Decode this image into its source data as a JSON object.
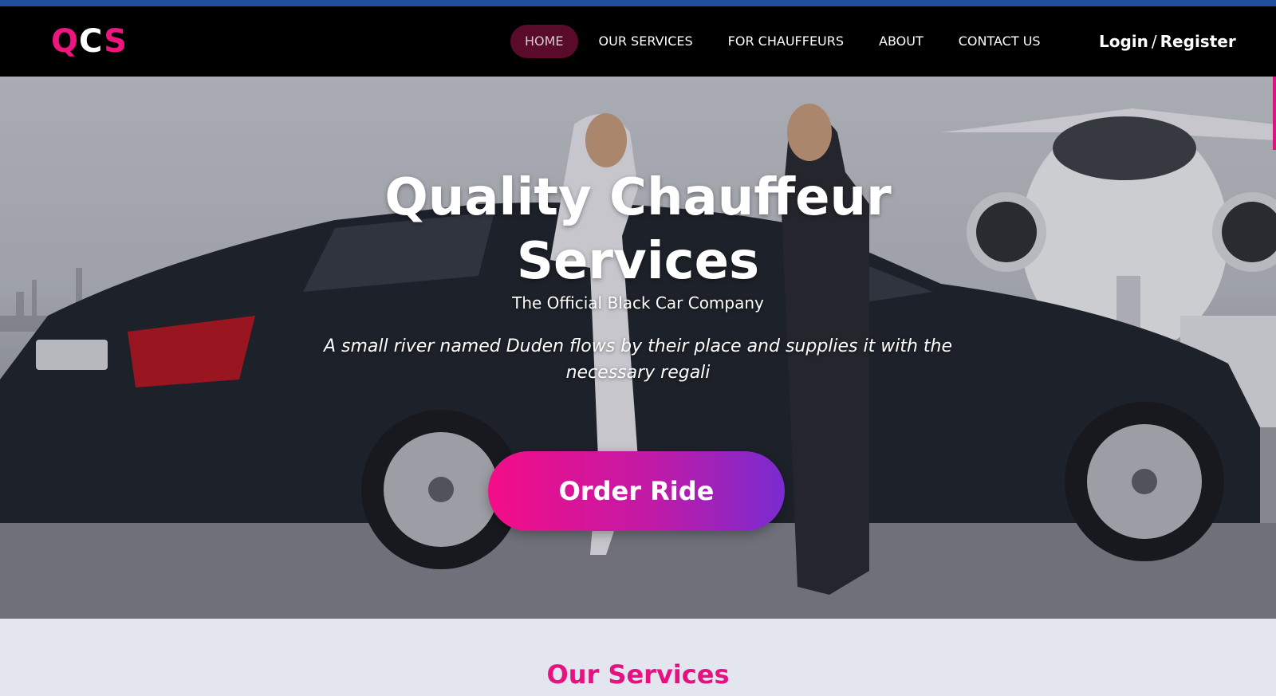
{
  "brand": {
    "logo_q": "Q",
    "logo_c": "C",
    "logo_s": "S",
    "accent_color": "#f0147f",
    "nav_bg": "#000000",
    "top_strip_color": "#1f4f9e"
  },
  "nav": {
    "items": [
      {
        "label": "HOME",
        "active": true
      },
      {
        "label": "OUR SERVICES",
        "active": false
      },
      {
        "label": "FOR CHAUFFEURS",
        "active": false
      },
      {
        "label": "ABOUT",
        "active": false
      },
      {
        "label": "CONTACT US",
        "active": false
      }
    ]
  },
  "auth": {
    "login": "Login",
    "separator": "/",
    "register": "Register"
  },
  "hero": {
    "title": "Quality Chauffeur Services",
    "subtitle": "The Official Black Car Company",
    "description": "A small river named Duden flows by their place and supplies it with the necessary regali",
    "cta_label": "Order Ride",
    "cta_gradient": [
      "#f40d88",
      "#7a2bd0"
    ]
  },
  "services": {
    "heading": "Our Services"
  }
}
